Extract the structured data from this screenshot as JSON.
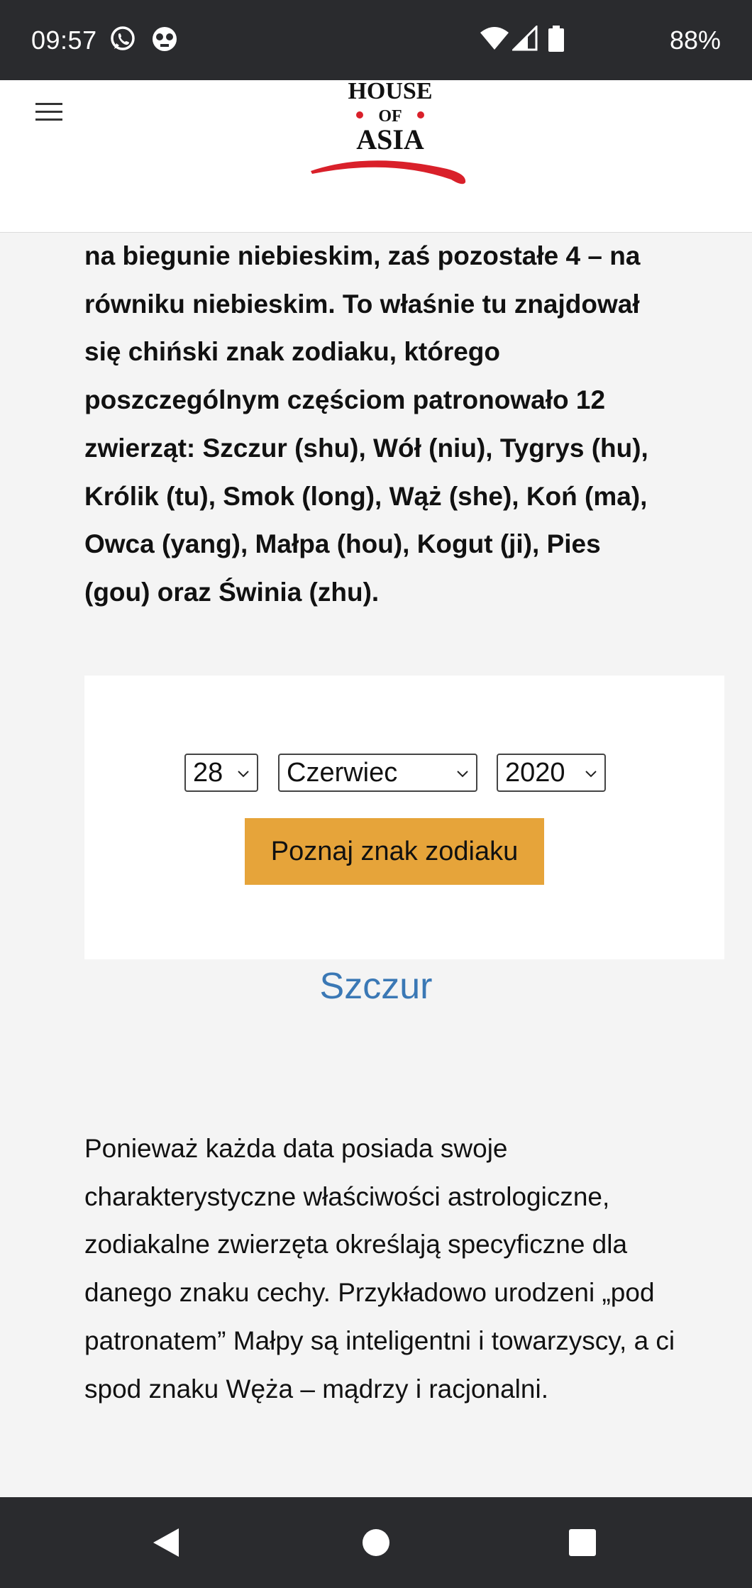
{
  "status_bar": {
    "time": "09:57",
    "battery": "88%",
    "icons": [
      "whatsapp-icon",
      "notification-icon",
      "wifi-icon",
      "signal-icon",
      "battery-icon"
    ]
  },
  "header": {
    "logo": {
      "line1": "HOUSE",
      "line2": "OF",
      "line3": "ASIA"
    },
    "menu_icon": "hamburger-icon"
  },
  "article": {
    "intro_paragraph": "na biegunie niebieskim, zaś pozostałe 4 – na równiku niebieskim. To właśnie tu znajdował się chiński znak zodiaku, którego poszczególnym częściom patronowało 12 zwierząt: Szczur (shu), Wół (niu), Tygrys (hu), Królik (tu), Smok (long), Wąż (she), Koń (ma), Owca (yang), Małpa (hou), Kogut (ji), Pies (gou) oraz Świnia (zhu).",
    "second_paragraph": "Ponieważ każda data posiada swoje charakterystyczne właściwości astrologiczne, zodiakalne zwierzęta określają specyficzne dla danego znaku cechy. Przykładowo urodzeni „pod patronatem” Małpy są inteligentni i towarzyscy, a ci spod znaku Węża – mądrzy i racjonalni."
  },
  "calculator": {
    "day": "28",
    "month": "Czerwiec",
    "year": "2020",
    "button_label": "Poznaj znak zodiaku",
    "result": "Szczur"
  },
  "colors": {
    "button": "#e6a43a",
    "result_link": "#3a78b5",
    "logo_accent": "#d9202a",
    "system_bars": "#2a2b2e"
  }
}
